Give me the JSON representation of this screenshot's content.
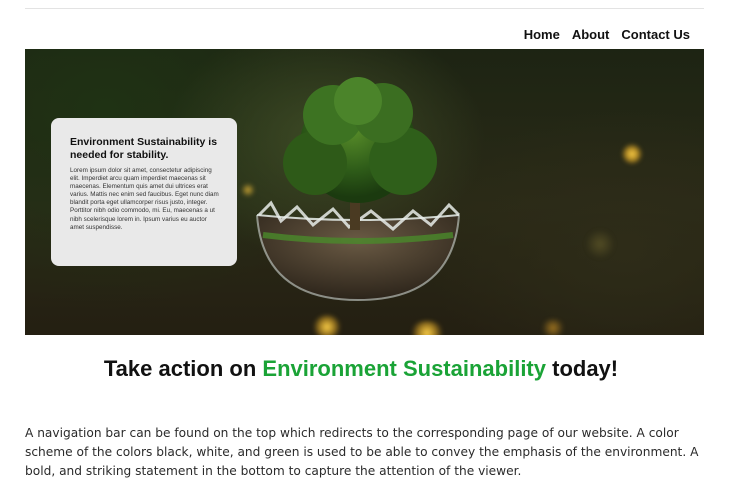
{
  "nav": {
    "items": [
      {
        "label": "Home"
      },
      {
        "label": "About"
      },
      {
        "label": "Contact Us"
      }
    ]
  },
  "hero": {
    "card_title": "Environment Sustainability is needed for stability.",
    "card_body": "Lorem ipsum dolor sit amet, consectetur adipiscing elit. Imperdiet arcu quam imperdiet maecenas sit maecenas. Elementum quis amet dui ultrices erat varius. Mattis nec enim sed faucibus. Eget nunc diam blandit porta eget ullamcorper risus justo, integer. Porttitor nibh odio commodo, mi. Eu, maecenas a ut nibh scelerisque lorem in. Ipsum varius eu auctor amet suspendisse."
  },
  "headline": {
    "prefix": "Take action on ",
    "accent": "Environment Sustainability",
    "suffix": " today!"
  },
  "description": "A navigation bar can be found on the top which redirects to the corresponding page of our website. A color scheme of the colors black, white, and green is used to be able to convey the emphasis of the environment. A bold, and striking statement in the bottom to capture the attention of the viewer.",
  "colors": {
    "accent_green": "#1aa336",
    "text": "#111111",
    "card_bg": "#e9e9e9"
  }
}
